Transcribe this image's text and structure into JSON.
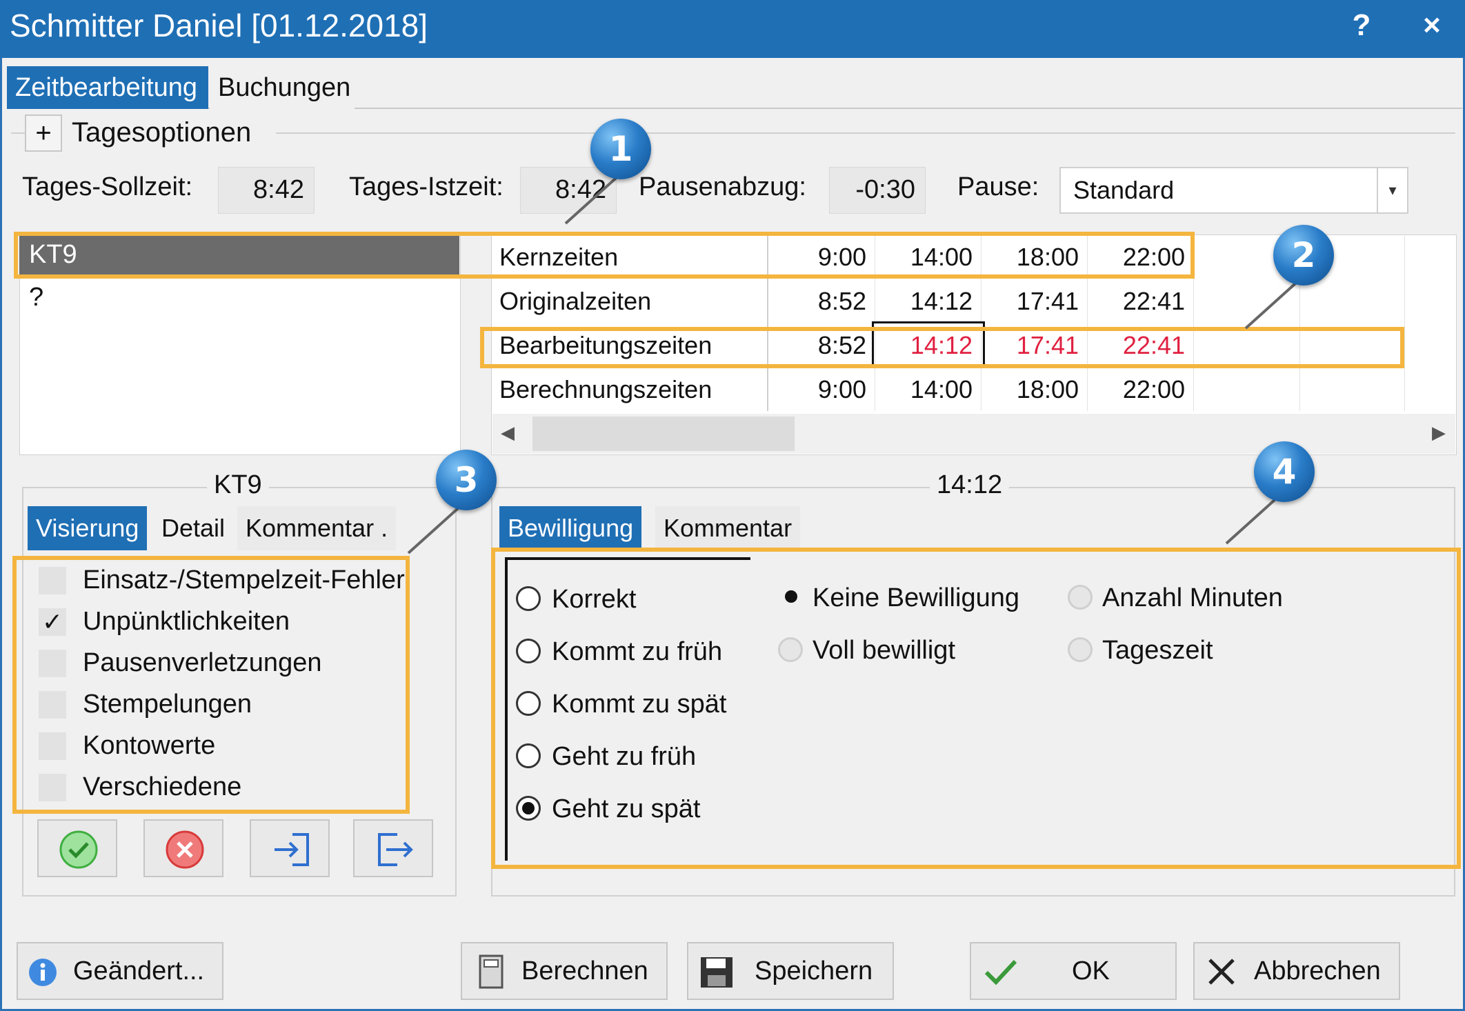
{
  "window": {
    "title": "Schmitter Daniel [01.12.2018]",
    "help_label": "?",
    "close_label": "×"
  },
  "tabs": [
    {
      "label": "Zeitbearbeitung"
    },
    {
      "label": "Buchungen"
    }
  ],
  "tagesoptionen": {
    "expander": "+",
    "label": "Tagesoptionen"
  },
  "summary": {
    "soll_label": "Tages-Sollzeit:",
    "soll_value": "8:42",
    "ist_label": "Tages-Istzeit:",
    "ist_value": "8:42",
    "pause_abzug_label": "Pausenabzug:",
    "pause_abzug_value": "-0:30",
    "pause_label": "Pause:",
    "pause_value": "Standard"
  },
  "left_list": [
    {
      "label": "KT9"
    },
    {
      "label": "?"
    }
  ],
  "grid": {
    "rows": [
      {
        "label": "Kernzeiten",
        "times": [
          "9:00",
          "14:00",
          "18:00",
          "22:00"
        ]
      },
      {
        "label": "Originalzeiten",
        "times": [
          "8:52",
          "14:12",
          "17:41",
          "22:41"
        ]
      },
      {
        "label": "Bearbeitungszeiten",
        "times": [
          "8:52",
          "14:12",
          "17:41",
          "22:41"
        ]
      },
      {
        "label": "Berechnungszeiten",
        "times": [
          "9:00",
          "14:00",
          "18:00",
          "22:00"
        ]
      }
    ]
  },
  "badges": [
    "1",
    "2",
    "3",
    "4"
  ],
  "left_panel": {
    "group_title": "KT9",
    "tabs": [
      {
        "label": "Visierung"
      },
      {
        "label": "Detail"
      },
      {
        "label": "Kommentar ."
      }
    ],
    "checks": [
      {
        "label": "Einsatz-/Stempelzeit-Fehler",
        "mark": ""
      },
      {
        "label": "Unpünktlichkeiten",
        "mark": "✓"
      },
      {
        "label": "Pausenverletzungen",
        "mark": ""
      },
      {
        "label": "Stempelungen",
        "mark": ""
      },
      {
        "label": "Kontowerte",
        "mark": ""
      },
      {
        "label": "Verschiedene",
        "mark": ""
      }
    ]
  },
  "right_panel": {
    "group_title": "14:12",
    "tabs": [
      {
        "label": "Bewilligung"
      },
      {
        "label": "Kommentar"
      }
    ],
    "radios_col1": [
      {
        "label": "Korrekt"
      },
      {
        "label": "Kommt zu früh"
      },
      {
        "label": "Kommt zu spät"
      },
      {
        "label": "Geht zu früh"
      },
      {
        "label": "Geht zu spät"
      }
    ],
    "radios_col2": [
      {
        "label": "Keine Bewilligung"
      },
      {
        "label": "Voll bewilligt"
      }
    ],
    "radios_col3": [
      {
        "label": "Anzahl Minuten"
      },
      {
        "label": "Tageszeit"
      }
    ]
  },
  "footer": {
    "geaendert": "Geändert...",
    "berechnen": "Berechnen",
    "speichern": "Speichern",
    "ok": "OK",
    "abbrechen": "Abbrechen"
  },
  "colors": {
    "accent": "#1f6fb5",
    "highlight": "#f4b53f",
    "red_time": "#e02040",
    "selected_row": "#6b6b6b"
  }
}
